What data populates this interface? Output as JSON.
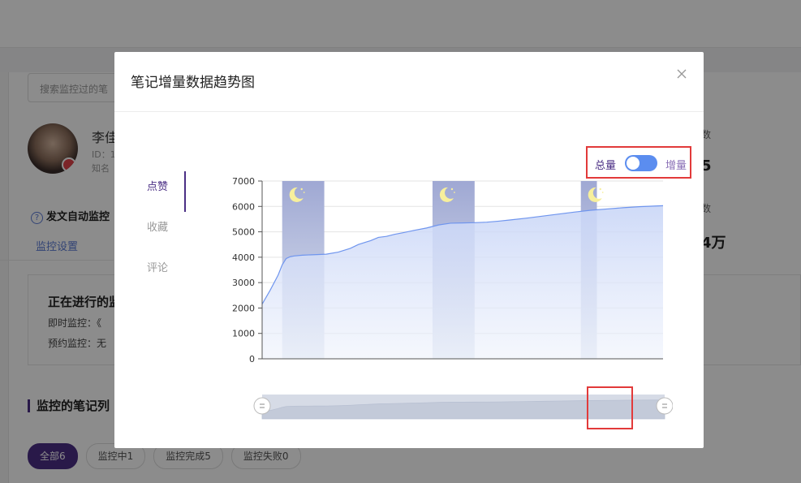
{
  "background": {
    "search_placeholder": "搜索监控过的笔",
    "profile": {
      "name": "李佳",
      "id_label": "ID：1",
      "known_label": "知名"
    },
    "auto_post_label": "发文自动监控",
    "question_mark": "?",
    "settings_link": "监控设置",
    "ongoing_card": {
      "title": "正在进行的监",
      "instant": "即时监控：《",
      "scheduled": "预约监控：无"
    },
    "right_stats": [
      {
        "label": "数",
        "value": "5"
      },
      {
        "label": "数",
        "value": "4万"
      }
    ],
    "list_title": "监控的笔记列",
    "filters": [
      {
        "label": "全部6",
        "active": true
      },
      {
        "label": "监控中1",
        "active": false
      },
      {
        "label": "监控完成5",
        "active": false
      },
      {
        "label": "监控失败0",
        "active": false
      }
    ]
  },
  "modal": {
    "title": "笔记增量数据趋势图",
    "close_icon": "close-icon",
    "tabs": [
      {
        "label": "点赞",
        "active": true
      },
      {
        "label": "收藏",
        "active": false
      },
      {
        "label": "评论",
        "active": false
      }
    ],
    "toggle": {
      "left_label": "总量",
      "right_label": "增量",
      "state": "off"
    }
  },
  "colors": {
    "accent": "#4b2f85",
    "line": "#6f95ee",
    "area_top": "#c9d6f7",
    "night_band": "#9fa8d3",
    "moon": "#f7ef9c",
    "highlight_box": "#e23a3a",
    "toggle": "#5b8def"
  },
  "chart_data": {
    "type": "area",
    "ylim": [
      0,
      7000
    ],
    "yticks": [
      0,
      1000,
      2000,
      3000,
      4000,
      5000,
      6000,
      7000
    ],
    "ytick_labels": [
      "0",
      "1000",
      "2000",
      "3000",
      "4000",
      "5000",
      "6000",
      "7000"
    ],
    "xlim": [
      0,
      100
    ],
    "series": [
      {
        "x": [
          0,
          2,
          4,
          5,
          6,
          7,
          8,
          10,
          13,
          16,
          19,
          22,
          24,
          26,
          27,
          29,
          31,
          33,
          35,
          38,
          41,
          44,
          47,
          50,
          53,
          56,
          59,
          62,
          66,
          70,
          74,
          78,
          82,
          86,
          90,
          94,
          97,
          100
        ],
        "y": [
          2150,
          2700,
          3300,
          3700,
          3950,
          4020,
          4050,
          4080,
          4100,
          4120,
          4200,
          4350,
          4500,
          4600,
          4650,
          4780,
          4820,
          4900,
          4960,
          5060,
          5150,
          5270,
          5340,
          5350,
          5360,
          5380,
          5420,
          5470,
          5540,
          5620,
          5700,
          5780,
          5850,
          5900,
          5950,
          5990,
          6010,
          6030
        ]
      }
    ],
    "night_bands": [
      [
        5,
        15.5
      ],
      [
        42.5,
        53
      ],
      [
        79.5,
        83.5
      ]
    ],
    "night_icon": "moon-icon",
    "zoom_range": [
      0,
      100
    ]
  }
}
